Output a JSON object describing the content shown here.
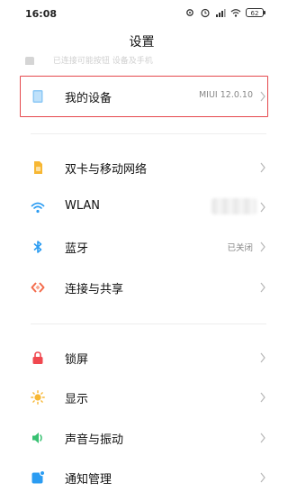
{
  "status_bar": {
    "time": "16:08",
    "battery": "62"
  },
  "header": {
    "title": "设置"
  },
  "faded_row": {
    "label": "已连接可能按钮 设备及手机"
  },
  "rows": [
    {
      "label": "我的设备",
      "value": "MIUI 12.0.10",
      "icon": "device-icon",
      "color": "#8cc8f5"
    },
    {
      "label": "双卡与移动网络",
      "value": "",
      "icon": "sim-card-icon",
      "color": "#f7b733"
    },
    {
      "label": "WLAN",
      "value": "",
      "icon": "wifi-icon",
      "color": "#2b9cf2"
    },
    {
      "label": "蓝牙",
      "value": "已关闭",
      "icon": "bluetooth-icon",
      "color": "#2b9cf2"
    },
    {
      "label": "连接与共享",
      "value": "",
      "icon": "connection-sharing-icon",
      "color": "#f36b4b"
    },
    {
      "label": "锁屏",
      "value": "",
      "icon": "lock-icon",
      "color": "#f0484f"
    },
    {
      "label": "显示",
      "value": "",
      "icon": "brightness-icon",
      "color": "#f7b733"
    },
    {
      "label": "声音与振动",
      "value": "",
      "icon": "sound-icon",
      "color": "#38c172"
    },
    {
      "label": "通知管理",
      "value": "",
      "icon": "notification-icon",
      "color": "#2b9cf2"
    }
  ],
  "colors": {
    "highlight": "#e5484d",
    "chevron": "#bbbbbb"
  }
}
